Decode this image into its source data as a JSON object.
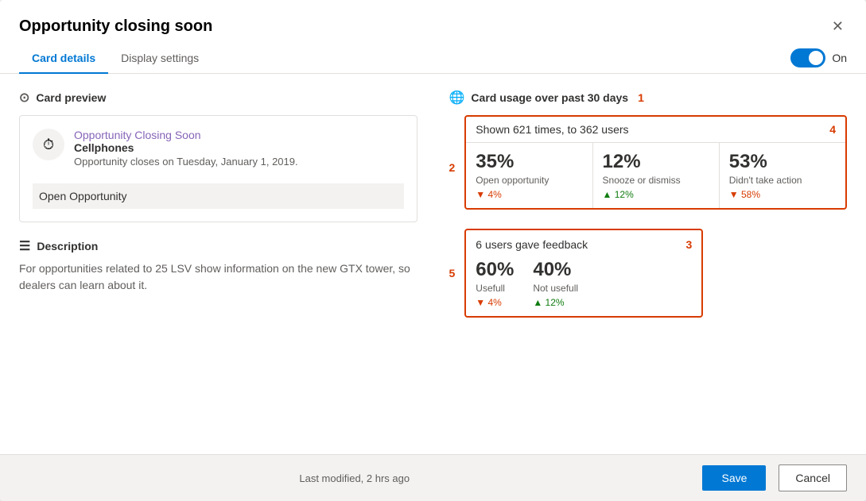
{
  "modal": {
    "title": "Opportunity closing soon",
    "close_icon": "✕"
  },
  "tabs": {
    "card_details_label": "Card details",
    "display_settings_label": "Display settings",
    "active": "card_details"
  },
  "toggle": {
    "label": "On",
    "on": true
  },
  "card_preview": {
    "section_label": "Card preview",
    "icon": "⏱",
    "card_name": "Opportunity Closing Soon",
    "card_subject": "Cellphones",
    "card_desc": "Opportunity closes on Tuesday, January 1, 2019.",
    "action_button": "Open Opportunity"
  },
  "description": {
    "section_label": "Description",
    "text": "For opportunities related to 25 LSV show information on the new GTX tower, so dealers can learn about it."
  },
  "usage": {
    "section_label": "Card usage over past 30 days",
    "annotation_1": "1",
    "shown_text": "Shown 621 times, to 362 users",
    "annotation_4": "4",
    "annotation_2": "2",
    "annotation_3": "3",
    "annotation_5": "5",
    "stats": [
      {
        "percent": "35%",
        "name": "Open opportunity",
        "change_direction": "down",
        "change_value": "▼ 4%"
      },
      {
        "percent": "12%",
        "name": "Snooze or dismiss",
        "change_direction": "up",
        "change_value": "▲ 12%"
      },
      {
        "percent": "53%",
        "name": "Didn't take action",
        "change_direction": "down",
        "change_value": "▼ 58%"
      }
    ],
    "feedback_title": "6 users gave feedback",
    "feedback_stats": [
      {
        "percent": "60%",
        "name": "Usefull",
        "change_direction": "down",
        "change_value": "▼ 4%"
      },
      {
        "percent": "40%",
        "name": "Not usefull",
        "change_direction": "up",
        "change_value": "▲ 12%"
      }
    ]
  },
  "footer": {
    "modified_text": "Last modified, 2 hrs ago",
    "save_label": "Save",
    "cancel_label": "Cancel"
  }
}
